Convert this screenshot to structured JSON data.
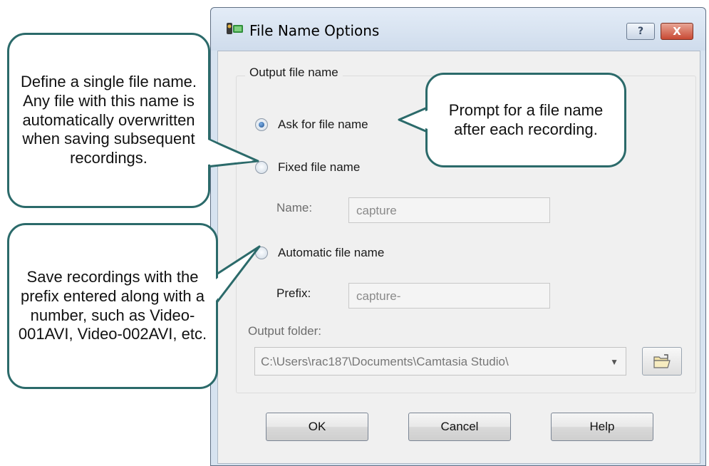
{
  "window": {
    "title": "File Name Options",
    "help_button": "?",
    "close_button": "X"
  },
  "group": {
    "legend": "Output file name"
  },
  "options": {
    "ask_label": "Ask for file name",
    "fixed_label": "Fixed file name",
    "name_label": "Name:",
    "name_value": "capture",
    "auto_label": "Automatic file name",
    "prefix_label": "Prefix:",
    "prefix_value": "capture-",
    "selected": "ask"
  },
  "output_folder": {
    "label": "Output folder:",
    "value": "C:\\Users\\rac187\\Documents\\Camtasia Studio\\"
  },
  "buttons": {
    "ok": "OK",
    "cancel": "Cancel",
    "help": "Help"
  },
  "callouts": {
    "fixed": "Define a single file name. Any file with this name is automatically overwritten when saving subsequent recordings.",
    "auto": "Save recordings with the prefix entered along with a number, such as Video-001AVI, Video-002AVI, etc.",
    "ask": "Prompt for a file name after each recording."
  },
  "colors": {
    "callout_border": "#2b6a6a",
    "window_frame": "#d7e3f0"
  },
  "icons": [
    "camera-icon",
    "help-icon",
    "close-icon",
    "chevron-down-icon",
    "open-folder-icon"
  ]
}
